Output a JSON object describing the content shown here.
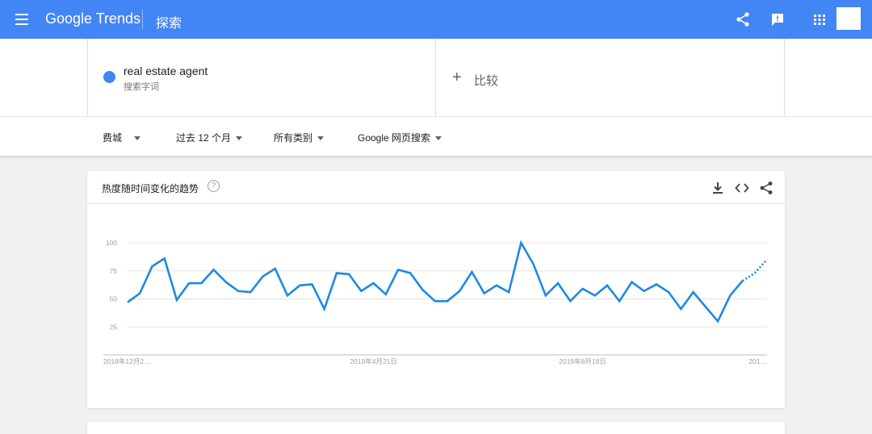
{
  "app": {
    "brand": "Google Trends",
    "page_title": "探索"
  },
  "header_icons": [
    "menu-icon",
    "share-icon",
    "feedback-icon",
    "apps-icon"
  ],
  "terms": [
    {
      "name": "real estate agent",
      "type": "搜索字词",
      "color": "#4285f4"
    }
  ],
  "compare": {
    "label": "比较"
  },
  "filters": [
    {
      "label": "费城"
    },
    {
      "label": "过去 12 个月"
    },
    {
      "label": "所有类别"
    },
    {
      "label": "Google 网页搜索"
    }
  ],
  "card": {
    "title": "热度随时间变化的趋势",
    "help": "?"
  },
  "colors": {
    "accent": "#4285f4",
    "series": "#1e88e5"
  },
  "chart_data": {
    "type": "line",
    "x": [
      "2018年12月2…",
      "2019年4月21日",
      "2019年8月18日",
      "201…"
    ],
    "x_ticks": [
      {
        "label": "2018年12月2…",
        "index": 0
      },
      {
        "label": "2019年4月21日",
        "index": 20
      },
      {
        "label": "2019年8月18日",
        "index": 37
      },
      {
        "label": "201…",
        "index": 52
      }
    ],
    "yticks": [
      "100",
      "75",
      "50",
      "25"
    ],
    "ylim": [
      0,
      100
    ],
    "series": [
      {
        "name": "real estate agent",
        "values": [
          47,
          55,
          79,
          86,
          49,
          64,
          64,
          76,
          65,
          57,
          56,
          70,
          77,
          53,
          62,
          63,
          41,
          73,
          72,
          57,
          64,
          54,
          76,
          73,
          58,
          48,
          48,
          57,
          74,
          55,
          62,
          56,
          100,
          81,
          53,
          64,
          48,
          59,
          53,
          62,
          48,
          65,
          57,
          63,
          56,
          41,
          56,
          43,
          30,
          53,
          66,
          73,
          85
        ],
        "partial_from_index": 50
      }
    ],
    "grid": true
  }
}
